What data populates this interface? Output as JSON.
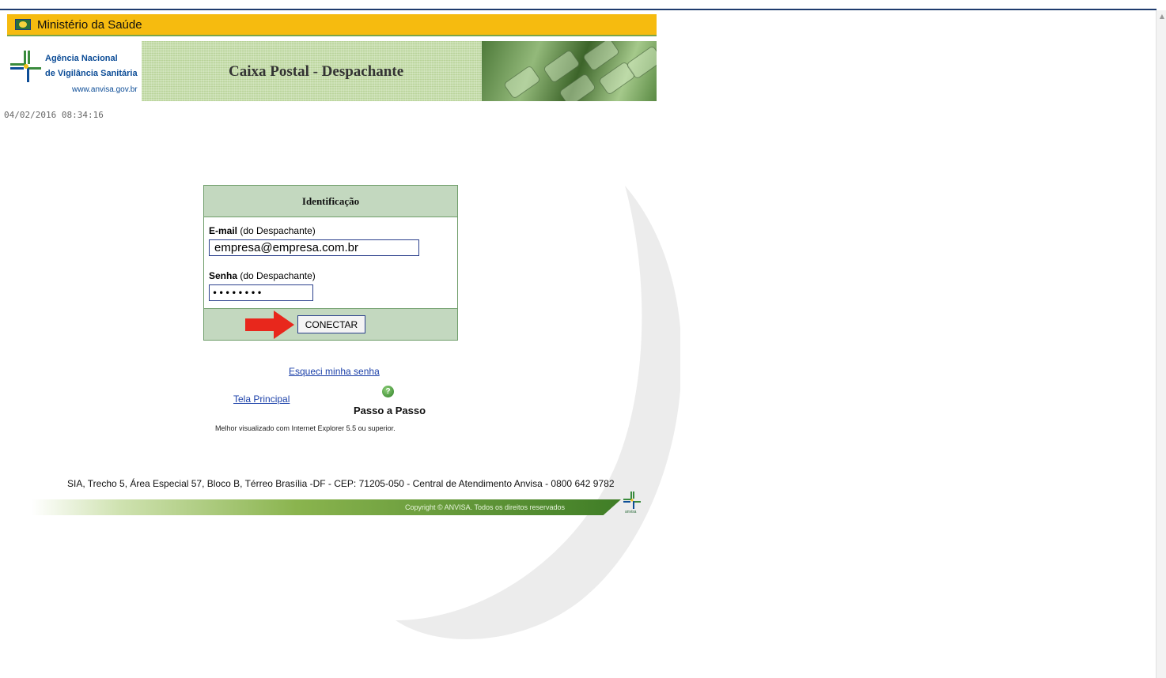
{
  "gov_bar": {
    "title": "Ministério da Saúde",
    "icon": "brazil-flag-icon"
  },
  "header": {
    "agency_line1": "Agência Nacional",
    "agency_line2": "de Vigilância Sanitária",
    "agency_url": "www.anvisa.gov.br",
    "page_title": "Caixa Postal - Despachante"
  },
  "timestamp": "04/02/2016 08:34:16",
  "login": {
    "heading": "Identificação",
    "email_label": "E-mail",
    "email_hint": " (do Despachante)",
    "email_value": "empresa@empresa.com.br",
    "password_label": "Senha",
    "password_hint": " (do Despachante)",
    "password_value": "••••••••",
    "connect_label": "CONECTAR"
  },
  "links": {
    "forgot_password": "Esqueci minha senha",
    "main_screen": "Tela Principal",
    "step_by_step": "Passo a Passo",
    "help_icon": "help-icon"
  },
  "notice": "Melhor visualizado com Internet Explorer 5.5 ou superior.",
  "footer": {
    "address": "SIA, Trecho 5, Área Especial 57, Bloco B, Térreo Brasília -DF - CEP: 71205-050 - Central de Atendimento Anvisa - 0800 642 9782",
    "copyright": "Copyright © ANVISA. Todos os direitos reservados",
    "small_logo_text": "anvisa"
  },
  "colors": {
    "gov_bar": "#f6bb0f",
    "green_panel": "#c3d8bf",
    "link": "#1a3fa8",
    "accent_arrow": "#e8271c"
  }
}
